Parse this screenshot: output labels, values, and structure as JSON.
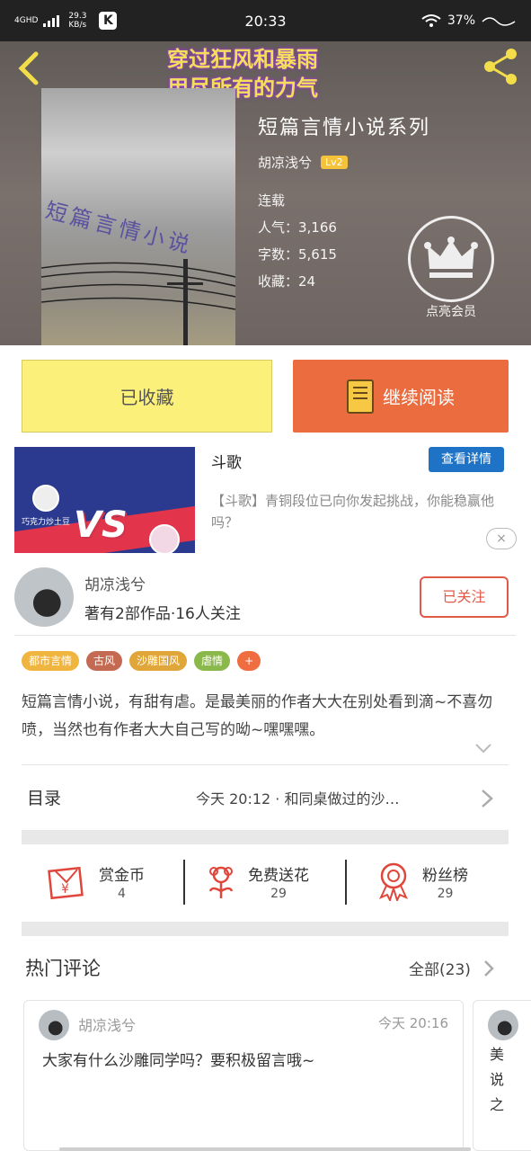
{
  "status_bar": {
    "network": "4GHD",
    "speed": "29.3",
    "speed_unit": "KB/s",
    "app_badge": "K",
    "time": "20:33",
    "battery": "37%"
  },
  "hero": {
    "slogan_line1": "穿过狂风和暴雨",
    "slogan_line2": "用尽所有的力气",
    "cover_text": "短篇言情小说",
    "title": "短篇言情小说系列",
    "author": "胡凉浅兮",
    "level": "Lv2",
    "status": "连载",
    "popularity": "人气：3,166",
    "word_count": "字数：5,615",
    "favorites": "收藏：24",
    "vip_label": "点亮会员"
  },
  "actions": {
    "fav_label": "已收藏",
    "read_label": "继续阅读"
  },
  "ad": {
    "avatar_name": "巧克力炒土豆",
    "title": "斗歌",
    "detail_button": "查看详情",
    "description": "【斗歌】青铜段位已向你发起挑战，你能稳赢他吗？",
    "close_icon": "×"
  },
  "author_card": {
    "name": "胡凉浅兮",
    "stats": "著有2部作品·16人关注",
    "follow_button": "已关注"
  },
  "tags": [
    {
      "label": "都市言情",
      "color": "#f0b53e"
    },
    {
      "label": "古风",
      "color": "#c56a52"
    },
    {
      "label": "沙雕国风",
      "color": "#e0a63a"
    },
    {
      "label": "虐情",
      "color": "#8bb84a"
    },
    {
      "label": "+",
      "color": "#f06d42"
    }
  ],
  "description": "短篇言情小说，有甜有虐。是最美丽的作者大大在别处看到滴~不喜勿喷，当然也有作者大大自己写的呦~嘿嘿嘿。",
  "catalog": {
    "label": "目录",
    "latest": "今天 20:12 · 和同桌做过的沙…"
  },
  "stats": [
    {
      "label": "赏金币",
      "value": "4"
    },
    {
      "label": "免费送花",
      "value": "29"
    },
    {
      "label": "粉丝榜",
      "value": "29"
    }
  ],
  "hot_comments": {
    "title": "热门评论",
    "all_label": "全部(23)",
    "comments": [
      {
        "name": "胡凉浅兮",
        "time": "今天 20:16",
        "text": "大家有什么沙雕同学吗？要积极留言哦~"
      }
    ],
    "partial_text": "美说之"
  }
}
